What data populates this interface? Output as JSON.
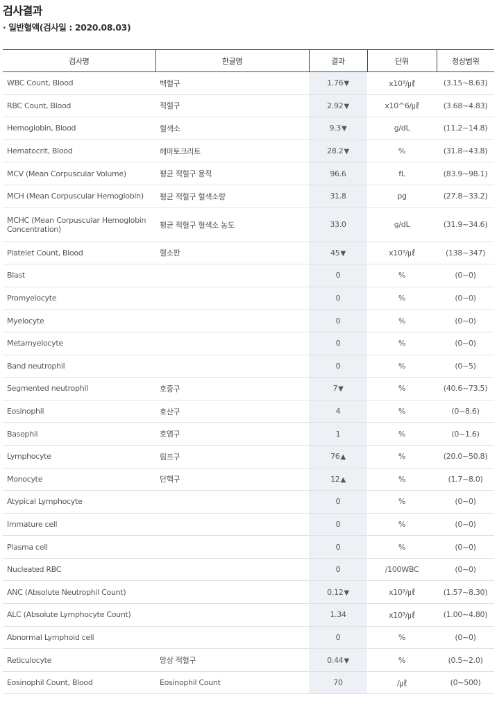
{
  "page": {
    "title": "검사결과",
    "subtitle": "일반혈액(검사일 : 2020.08.03)",
    "bullet": "·"
  },
  "table": {
    "headers": [
      "검사명",
      "한글명",
      "결과",
      "단위",
      "정상범위"
    ],
    "rows": [
      {
        "name": "WBC Count, Blood",
        "kr": "백혈구",
        "result": "1.76",
        "flag": "low",
        "unit": "x10³/㎕",
        "range": "(3.15~8.63)"
      },
      {
        "name": "RBC Count, Blood",
        "kr": "적혈구",
        "result": "2.92",
        "flag": "low",
        "unit": "x10^6/㎕",
        "range": "(3.68~4.83)"
      },
      {
        "name": "Hemoglobin, Blood",
        "kr": "혈색소",
        "result": "9.3",
        "flag": "low",
        "unit": "g/dL",
        "range": "(11.2~14.8)"
      },
      {
        "name": "Hematocrit, Blood",
        "kr": "헤마토크리트",
        "result": "28.2",
        "flag": "low",
        "unit": "%",
        "range": "(31.8~43.8)"
      },
      {
        "name": "MCV (Mean Corpuscular Volume)",
        "kr": "평균 적혈구 용적",
        "result": "96.6",
        "flag": "",
        "unit": "fL",
        "range": "(83.9~98.1)"
      },
      {
        "name": "MCH (Mean Corpuscular Hemoglobin)",
        "kr": "평균 적혈구 혈색소량",
        "result": "31.8",
        "flag": "",
        "unit": "pg",
        "range": "(27.8~33.2)"
      },
      {
        "name": "MCHC (Mean Corpuscular Hemoglobin Concentration)",
        "kr": "평균 적혈구 혈색소 농도",
        "result": "33.0",
        "flag": "",
        "unit": "g/dL",
        "range": "(31.9~34.6)",
        "tall": true
      },
      {
        "name": "Platelet Count, Blood",
        "kr": "혈소판",
        "result": "45",
        "flag": "low",
        "unit": "x10³/㎕",
        "range": "(138~347)"
      },
      {
        "name": "Blast",
        "kr": "",
        "result": "0",
        "flag": "",
        "unit": "%",
        "range": "(0~0)"
      },
      {
        "name": "Promyelocyte",
        "kr": "",
        "result": "0",
        "flag": "",
        "unit": "%",
        "range": "(0~0)"
      },
      {
        "name": "Myelocyte",
        "kr": "",
        "result": "0",
        "flag": "",
        "unit": "%",
        "range": "(0~0)"
      },
      {
        "name": "Metamyelocyte",
        "kr": "",
        "result": "0",
        "flag": "",
        "unit": "%",
        "range": "(0~0)"
      },
      {
        "name": "Band neutrophil",
        "kr": "",
        "result": "0",
        "flag": "",
        "unit": "%",
        "range": "(0~5)"
      },
      {
        "name": "Segmented neutrophil",
        "kr": "호중구",
        "result": "7",
        "flag": "low",
        "unit": "%",
        "range": "(40.6~73.5)"
      },
      {
        "name": "Eosinophil",
        "kr": "호산구",
        "result": "4",
        "flag": "",
        "unit": "%",
        "range": "(0~8.6)"
      },
      {
        "name": "Basophil",
        "kr": "호염구",
        "result": "1",
        "flag": "",
        "unit": "%",
        "range": "(0~1.6)"
      },
      {
        "name": "Lymphocyte",
        "kr": "림프구",
        "result": "76",
        "flag": "high",
        "unit": "%",
        "range": "(20.0~50.8)"
      },
      {
        "name": "Monocyte",
        "kr": "단핵구",
        "result": "12",
        "flag": "high",
        "unit": "%",
        "range": "(1.7~8.0)"
      },
      {
        "name": "Atypical Lymphocyte",
        "kr": "",
        "result": "0",
        "flag": "",
        "unit": "%",
        "range": "(0~0)"
      },
      {
        "name": "Immature cell",
        "kr": "",
        "result": "0",
        "flag": "",
        "unit": "%",
        "range": "(0~0)"
      },
      {
        "name": "Plasma cell",
        "kr": "",
        "result": "0",
        "flag": "",
        "unit": "%",
        "range": "(0~0)"
      },
      {
        "name": "Nucleated RBC",
        "kr": "",
        "result": "0",
        "flag": "",
        "unit": "/100WBC",
        "range": "(0~0)"
      },
      {
        "name": "ANC (Absolute Neutrophil Count)",
        "kr": "",
        "result": "0.12",
        "flag": "low",
        "unit": "x10³/㎕",
        "range": "(1.57~8.30)"
      },
      {
        "name": "ALC (Absolute Lymphocyte Count)",
        "kr": "",
        "result": "1.34",
        "flag": "",
        "unit": "x10³/㎕",
        "range": "(1.00~4.80)"
      },
      {
        "name": "Abnormal Lymphoid cell",
        "kr": "",
        "result": "0",
        "flag": "",
        "unit": "%",
        "range": "(0~0)"
      },
      {
        "name": "Reticulocyte",
        "kr": "망상 적혈구",
        "result": "0.44",
        "flag": "low",
        "unit": "%",
        "range": "(0.5~2.0)"
      },
      {
        "name": "Eosinophil Count, Blood",
        "kr": "Eosinophil Count",
        "result": "70",
        "flag": "",
        "unit": "/㎕",
        "range": "(0~500)"
      }
    ]
  },
  "icons": {
    "low": "down-triangle-icon",
    "high": "up-triangle-icon"
  },
  "colors": {
    "low": "#3a6fd8",
    "high": "#e0731e",
    "result_column_bg": "#edf0f5"
  }
}
